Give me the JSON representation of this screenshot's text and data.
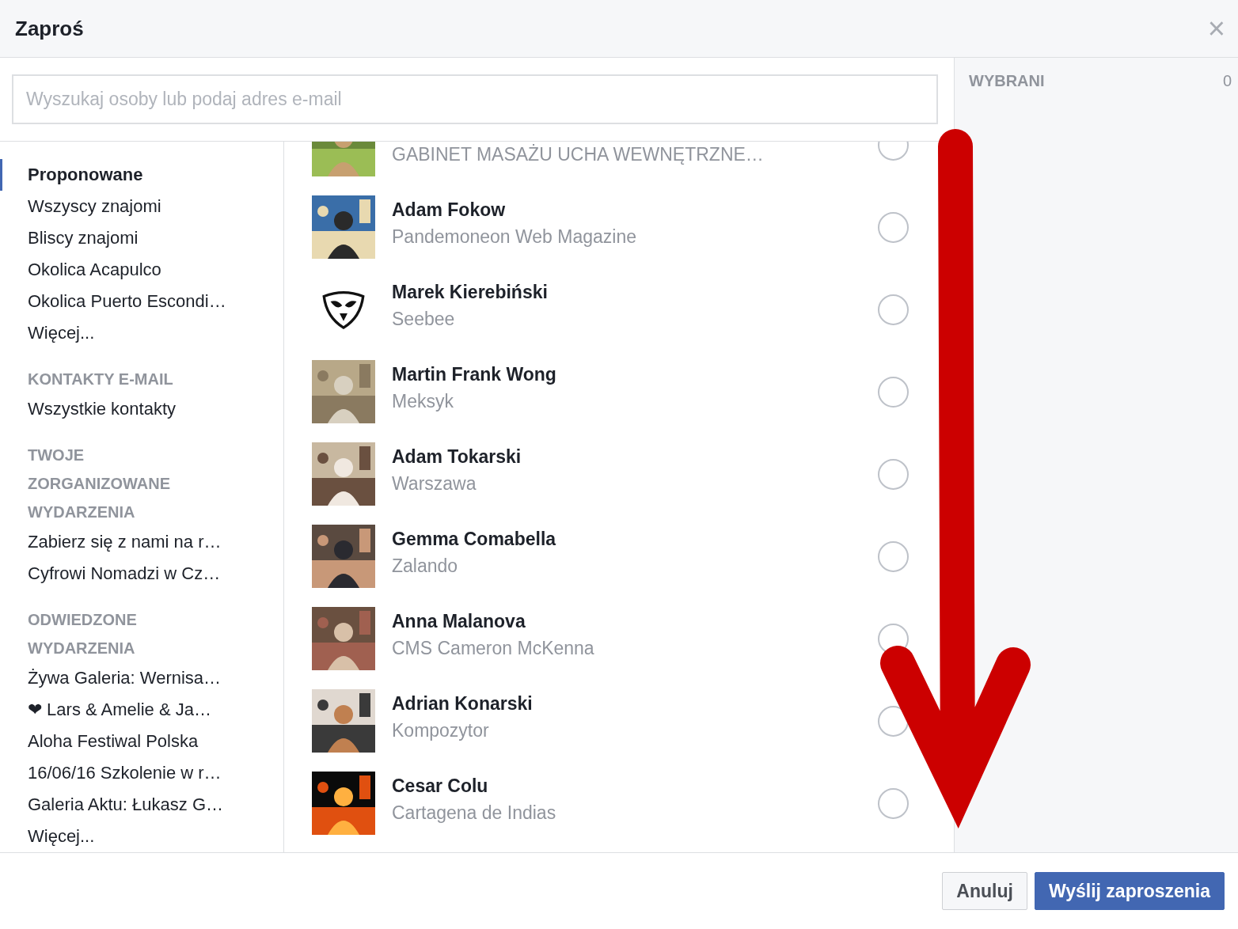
{
  "dialog": {
    "title": "Zaproś",
    "close": "×"
  },
  "search": {
    "placeholder": "Wyszukaj osoby lub podaj adres e-mail"
  },
  "sidebar": {
    "sections": [
      {
        "items": [
          {
            "label": "Proponowane",
            "selected": true
          },
          {
            "label": "Wszyscy znajomi",
            "selected": false
          },
          {
            "label": "Bliscy znajomi",
            "selected": false
          },
          {
            "label": "Okolica Acapulco",
            "selected": false
          },
          {
            "label": "Okolica Puerto Escondi…",
            "selected": false
          },
          {
            "label": "Więcej...",
            "selected": false
          }
        ]
      },
      {
        "header": "KONTAKTY E-MAIL",
        "items": [
          {
            "label": "Wszystkie kontakty",
            "selected": false
          }
        ]
      },
      {
        "header": "TWOJE ZORGANIZOWANE WYDARZENIA",
        "items": [
          {
            "label": "Zabierz się z nami na r…",
            "selected": false
          },
          {
            "label": "Cyfrowi Nomadzi w Cz…",
            "selected": false
          }
        ]
      },
      {
        "header": "ODWIEDZONE WYDARZENIA",
        "items": [
          {
            "label": "Żywa Galeria: Wernisa…",
            "selected": false
          },
          {
            "label": "❤ Lars & Amelie & Ja…",
            "selected": false
          },
          {
            "label": "Aloha Festiwal Polska",
            "selected": false
          },
          {
            "label": "16/06/16 Szkolenie w r…",
            "selected": false
          },
          {
            "label": "Galeria Aktu: Łukasz G…",
            "selected": false
          },
          {
            "label": "Więcej...",
            "selected": false
          }
        ]
      }
    ]
  },
  "people": [
    {
      "subtitle": "GABINET MASAŻU UCHA WEWNĘTRZNE…",
      "kind": "picture",
      "selected": false
    },
    {
      "name": "Adam Fokow",
      "subtitle": "Pandemoneon Web Magazine",
      "kind": "picture",
      "selected": false
    },
    {
      "name": "Marek Kierebiński",
      "subtitle": "Seebee",
      "kind": "logo",
      "selected": false
    },
    {
      "name": "Martin Frank Wong",
      "subtitle": "Meksyk",
      "kind": "picture",
      "selected": false
    },
    {
      "name": "Adam Tokarski",
      "subtitle": "Warszawa",
      "kind": "picture",
      "selected": false
    },
    {
      "name": "Gemma Comabella",
      "subtitle": "Zalando",
      "kind": "picture",
      "selected": false
    },
    {
      "name": "Anna Malanova",
      "subtitle": "CMS Cameron McKenna",
      "kind": "picture",
      "selected": false
    },
    {
      "name": "Adrian Konarski",
      "subtitle": "Kompozytor",
      "kind": "picture",
      "selected": false
    },
    {
      "name": "Cesar Colu",
      "subtitle": "Cartagena de Indias",
      "kind": "picture",
      "selected": false
    }
  ],
  "selected_panel": {
    "title": "WYBRANI",
    "count": "0"
  },
  "buttons": [
    {
      "label": "Anuluj",
      "kind": "secondary"
    },
    {
      "label": "Wyślij zaproszenia",
      "kind": "primary"
    }
  ]
}
